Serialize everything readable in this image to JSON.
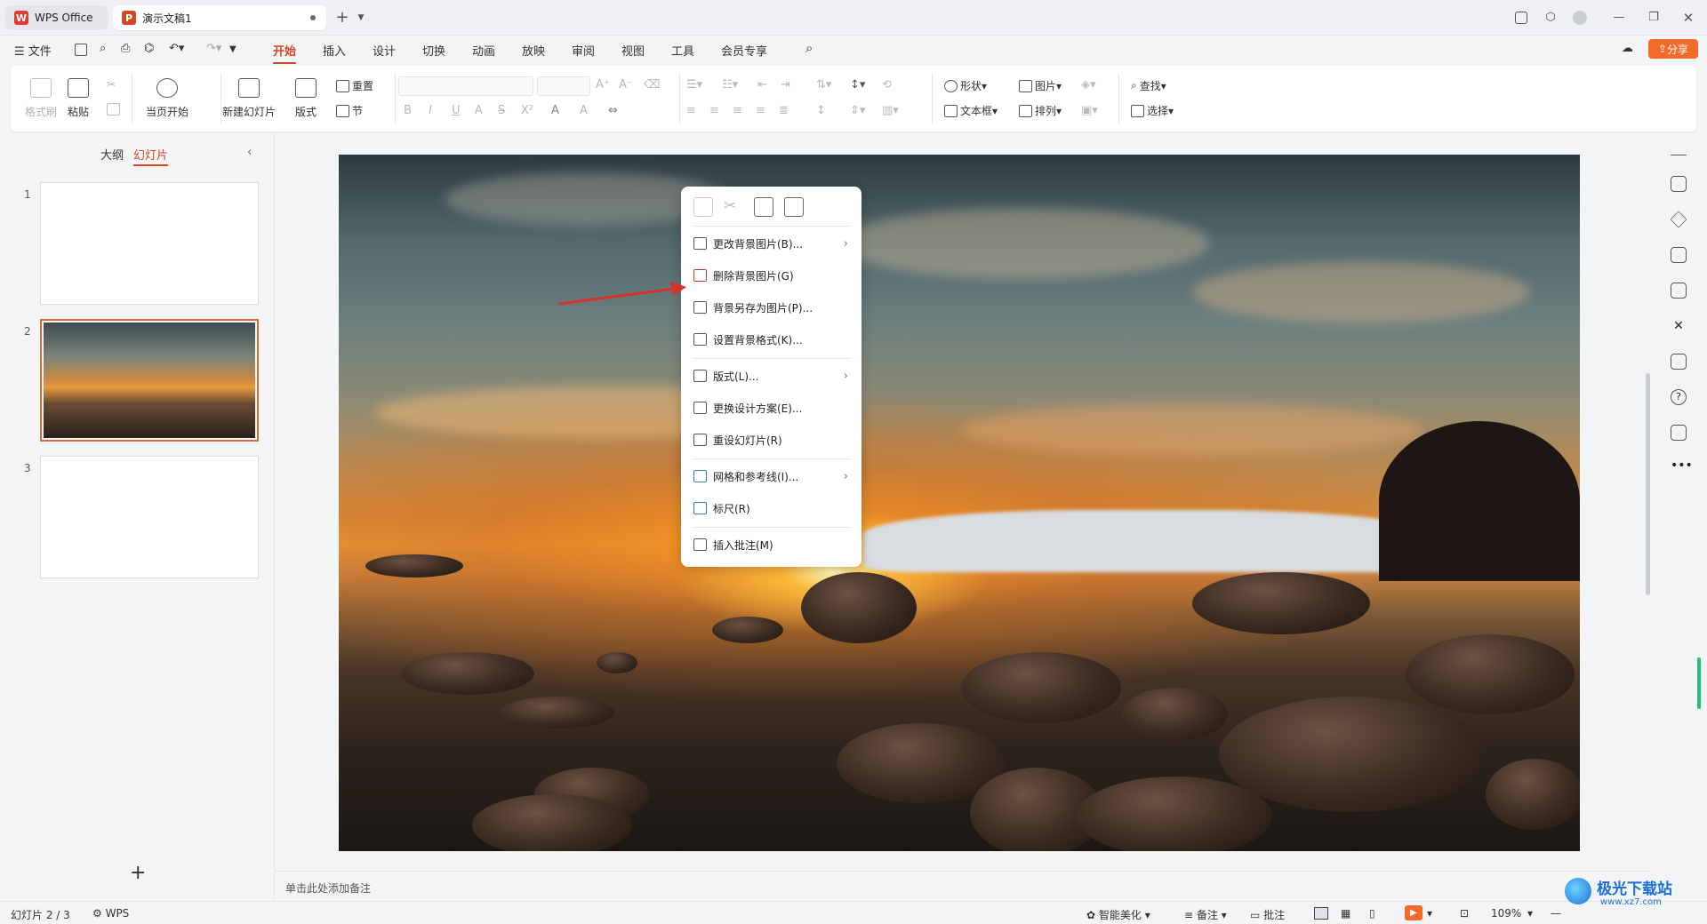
{
  "titlebar": {
    "home_tab": "WPS Office",
    "doc_tab": "演示文稿1",
    "new_tab": "+"
  },
  "menubar": {
    "file": "文件",
    "items": [
      "开始",
      "插入",
      "设计",
      "切换",
      "动画",
      "放映",
      "审阅",
      "视图",
      "工具",
      "会员专享"
    ],
    "active": "开始",
    "share": "分享"
  },
  "ribbon": {
    "format_painter": "格式刷",
    "paste": "粘贴",
    "play_current": "当页开始",
    "new_slide": "新建幻灯片",
    "layout": "版式",
    "reset": "重置",
    "section": "节",
    "shape": "形状",
    "picture": "图片",
    "textbox": "文本框",
    "arrange": "排列",
    "find": "查找",
    "select": "选择",
    "format_glyphs": [
      "B",
      "I",
      "U",
      "A",
      "S",
      "X²",
      "A",
      "A"
    ]
  },
  "leftpane": {
    "tab_outline": "大纲",
    "tab_slides": "幻灯片",
    "slides": [
      {
        "num": "1"
      },
      {
        "num": "2"
      },
      {
        "num": "3"
      }
    ],
    "add": "+"
  },
  "context_menu": {
    "items": [
      {
        "label": "更改背景图片(B)...",
        "submenu": true
      },
      {
        "label": "删除背景图片(G)",
        "submenu": false
      },
      {
        "label": "背景另存为图片(P)...",
        "submenu": false
      },
      {
        "label": "设置背景格式(K)...",
        "submenu": false
      },
      {
        "label": "版式(L)...",
        "submenu": true
      },
      {
        "label": "更换设计方案(E)...",
        "submenu": false
      },
      {
        "label": "重设幻灯片(R)",
        "submenu": false
      },
      {
        "label": "网格和参考线(I)...",
        "submenu": true
      },
      {
        "label": "标尺(R)",
        "submenu": false
      },
      {
        "label": "插入批注(M)",
        "submenu": false
      }
    ]
  },
  "notes": {
    "placeholder": "单击此处添加备注"
  },
  "status": {
    "slide_info": "幻灯片 2 / 3",
    "theme": "WPS",
    "beautify": "智能美化",
    "notes": "备注",
    "comments": "批注",
    "zoom": "109%"
  },
  "watermark": {
    "text": "极光下载站",
    "url": "www.xz7.com"
  },
  "colors": {
    "accent": "#d24726",
    "share": "#f26b2b",
    "arrow": "#d9302c"
  }
}
